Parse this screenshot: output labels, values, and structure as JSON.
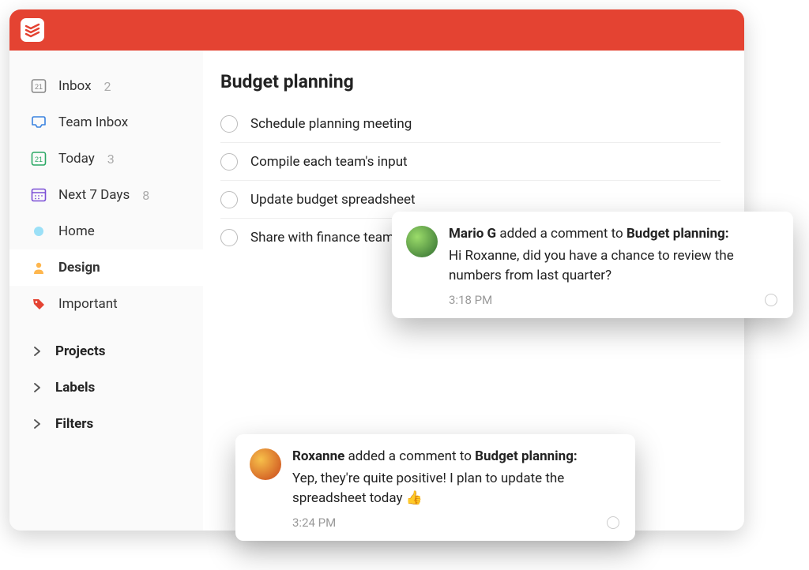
{
  "sidebar": {
    "inbox": {
      "label": "Inbox",
      "count": "2"
    },
    "team_inbox": {
      "label": "Team Inbox"
    },
    "today": {
      "label": "Today",
      "count": "3"
    },
    "next7": {
      "label": "Next 7 Days",
      "count": "8"
    },
    "home": {
      "label": "Home"
    },
    "design": {
      "label": "Design"
    },
    "important": {
      "label": "Important"
    },
    "projects": {
      "label": "Projects"
    },
    "labels": {
      "label": "Labels"
    },
    "filters": {
      "label": "Filters"
    }
  },
  "main": {
    "title": "Budget planning",
    "tasks": [
      "Schedule planning meeting",
      "Compile each team's input",
      "Update budget spreadsheet",
      "Share with finance team"
    ]
  },
  "notifications": [
    {
      "author": "Mario G",
      "middle": " added a comment to ",
      "project": "Budget planning:",
      "message": "Hi Roxanne, did you have a chance to review the numbers from last quarter?",
      "time": "3:18 PM"
    },
    {
      "author": "Roxanne",
      "middle": " added a comment to ",
      "project": "Budget planning:",
      "message": "Yep, they're quite positive! I plan to update the spreadsheet today 👍",
      "time": "3:24 PM"
    }
  ]
}
